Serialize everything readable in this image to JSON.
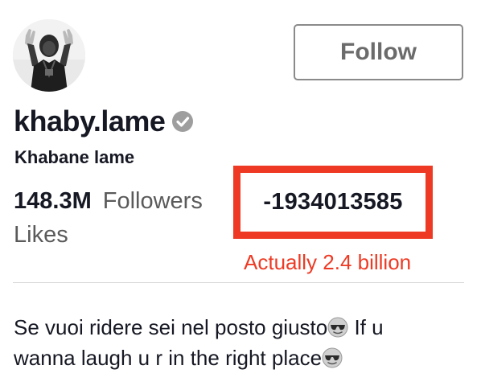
{
  "profile": {
    "username": "khaby.lame",
    "display_name": "Khabane lame",
    "avatar_icon": "profile-photo-avatar",
    "verified_icon": "verified-badge-icon"
  },
  "follow_button": {
    "label": "Follow"
  },
  "stats": {
    "followers_count": "148.3M",
    "followers_label": "Followers",
    "likes_count": "-1934013585",
    "likes_label": "Likes"
  },
  "annotation": {
    "text": "Actually 2.4 billion",
    "color": "#ee3a24"
  },
  "bio": {
    "line1_text": "Se vuoi ridere sei nel posto giusto",
    "line1_text_after": " If u",
    "line2_text": "wanna laugh u r in the right place",
    "emoji_icon": "sunglasses-emoji-icon"
  },
  "colors": {
    "text_primary": "#161823",
    "text_secondary": "#5a5a5a",
    "highlight_border": "#ee3a24",
    "button_border": "#8a8a8a",
    "divider": "#d6d6d6"
  }
}
